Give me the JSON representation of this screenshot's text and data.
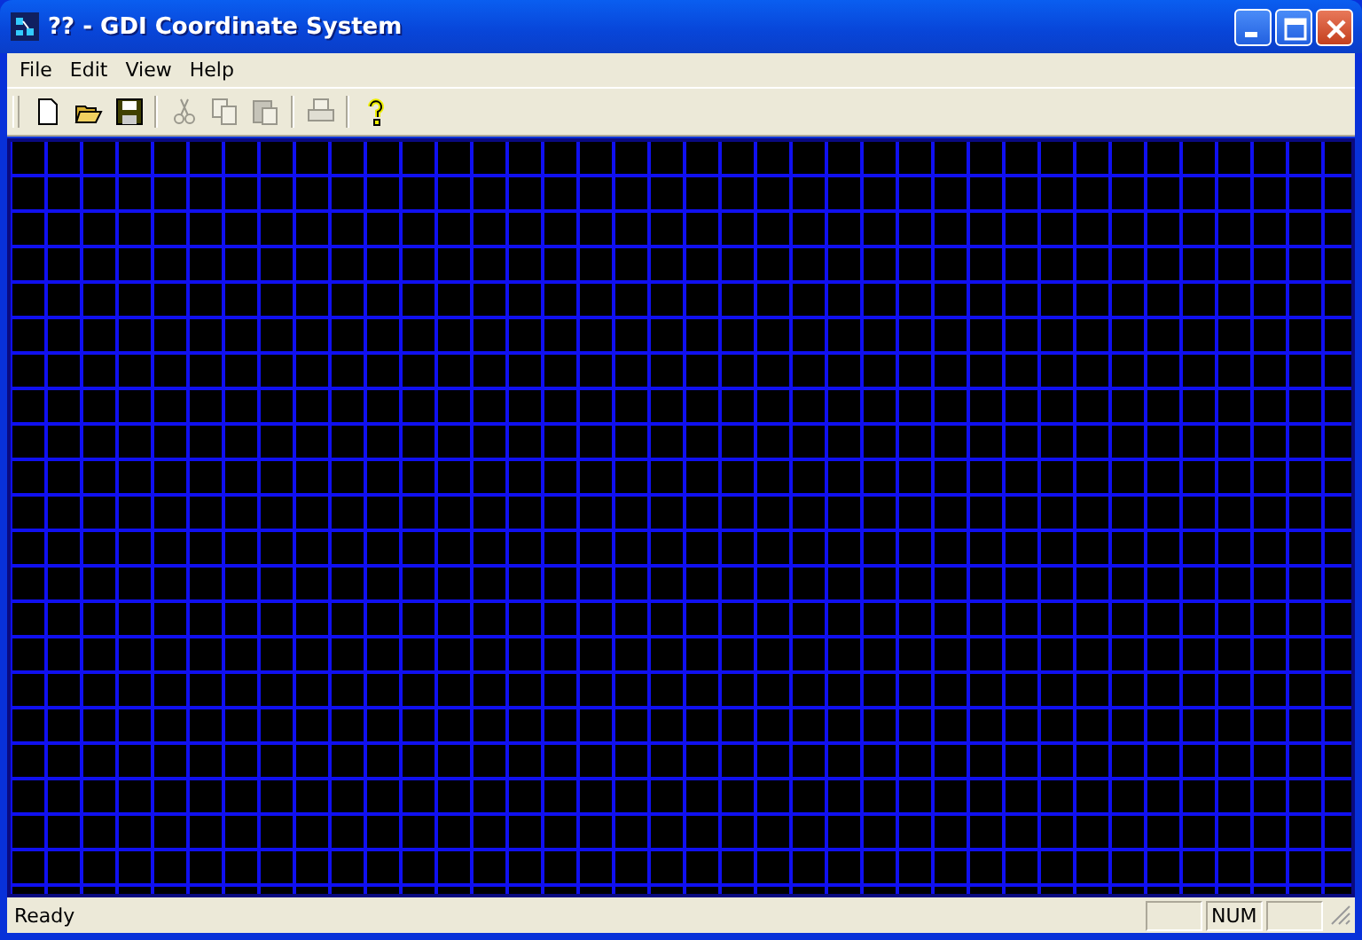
{
  "window": {
    "title": "?? - GDI Coordinate System"
  },
  "menu": [
    "File",
    "Edit",
    "View",
    "Help"
  ],
  "toolbar": [
    [
      {
        "kind": "new",
        "disabled": false
      },
      {
        "kind": "open",
        "disabled": false
      },
      {
        "kind": "save",
        "disabled": false
      }
    ],
    [
      {
        "kind": "cut",
        "disabled": true
      },
      {
        "kind": "copy",
        "disabled": true
      },
      {
        "kind": "paste",
        "disabled": true
      }
    ],
    [
      {
        "kind": "print",
        "disabled": true
      }
    ],
    [
      {
        "kind": "help",
        "disabled": false
      }
    ]
  ],
  "status_bar": {
    "message": "Ready",
    "indicators": [
      "NUM"
    ]
  }
}
